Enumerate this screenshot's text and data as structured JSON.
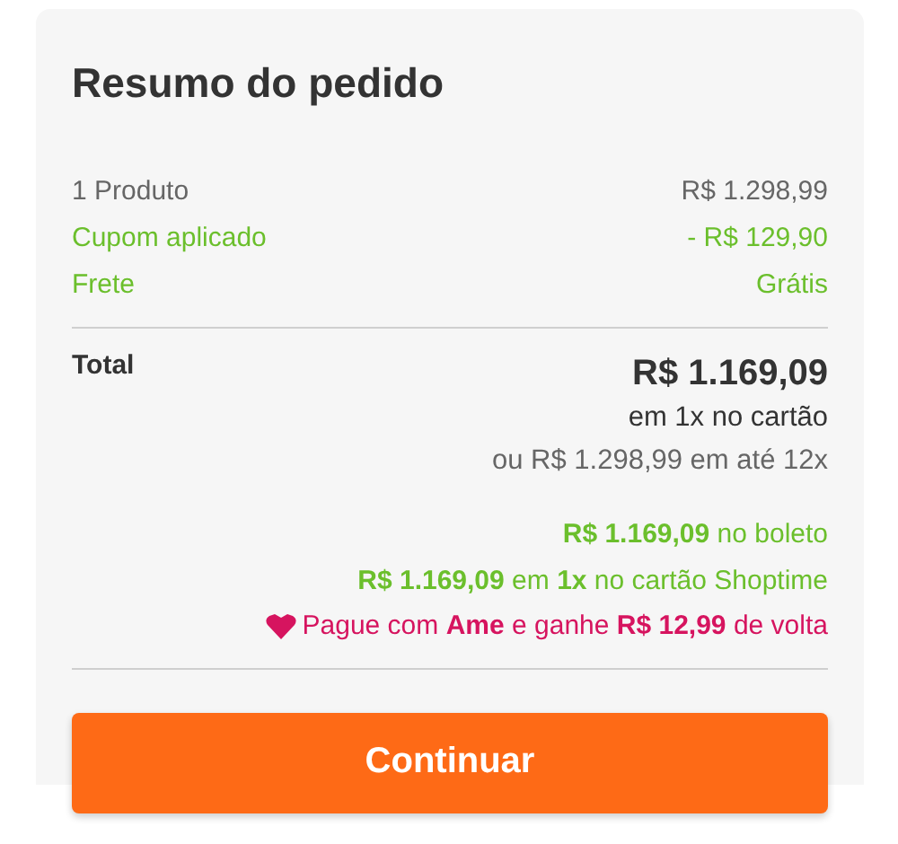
{
  "title": "Resumo do pedido",
  "lines": [
    {
      "kind": "normal",
      "label": "1 Produto",
      "value": "R$ 1.298,99"
    },
    {
      "kind": "discount",
      "label": "Cupom aplicado",
      "value": "- R$ 129,90"
    },
    {
      "kind": "discount",
      "label": "Frete",
      "value": "Grátis"
    }
  ],
  "total": {
    "label": "Total",
    "amount": "R$ 1.169,09",
    "note": "em 1x no cartão",
    "installments": "ou R$ 1.298,99 em até 12x"
  },
  "offers": [
    {
      "kind": "green",
      "text": "**R$ 1.169,09** no boleto"
    },
    {
      "kind": "green",
      "text": "**R$ 1.169,09** em **1x** no cartão Shoptime"
    },
    {
      "kind": "ame",
      "text": "Pague com **Ame** e ganhe **R$ 12,99** de volta"
    }
  ],
  "button": "Continuar"
}
